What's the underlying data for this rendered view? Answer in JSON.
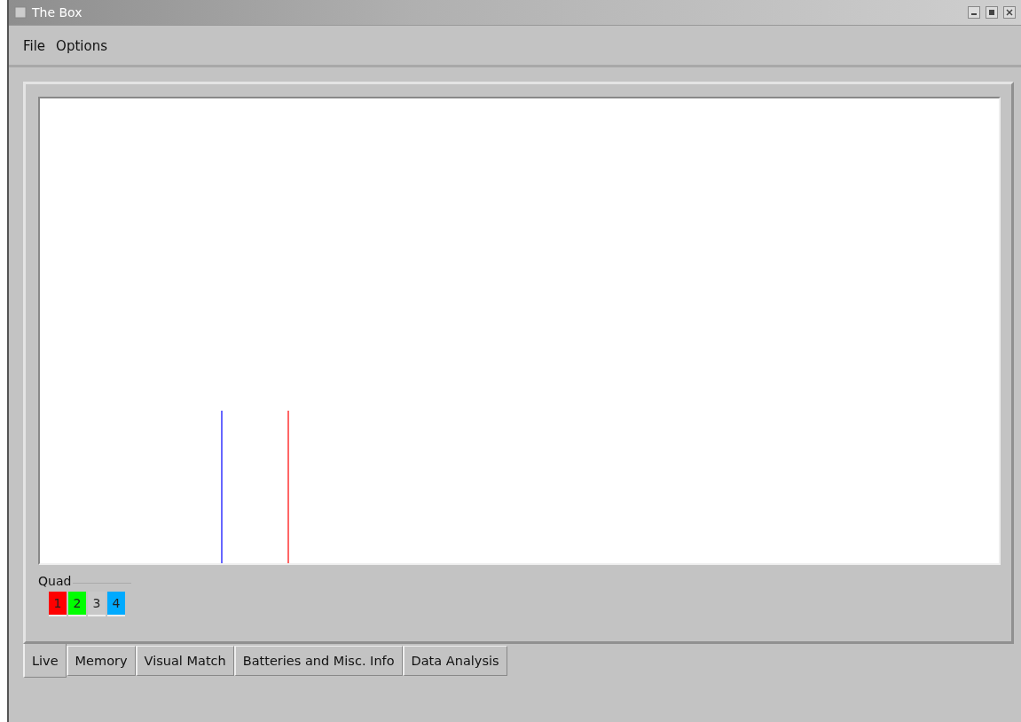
{
  "window": {
    "title": "The Box"
  },
  "menu": [
    {
      "label": "File"
    },
    {
      "label": "Options"
    }
  ],
  "quad": {
    "label": "Quad",
    "channels": [
      {
        "label": "1",
        "color": "#ff0000"
      },
      {
        "label": "2",
        "color": "#00ff00"
      },
      {
        "label": "3",
        "color": "#c8c8c8"
      },
      {
        "label": "4",
        "color": "#00aaff"
      }
    ]
  },
  "tabs": [
    {
      "label": "Live",
      "selected": true
    },
    {
      "label": "Memory",
      "selected": false
    },
    {
      "label": "Visual Match",
      "selected": false
    },
    {
      "label": "Batteries and Misc. Info",
      "selected": false
    },
    {
      "label": "Data Analysis",
      "selected": false
    }
  ]
}
